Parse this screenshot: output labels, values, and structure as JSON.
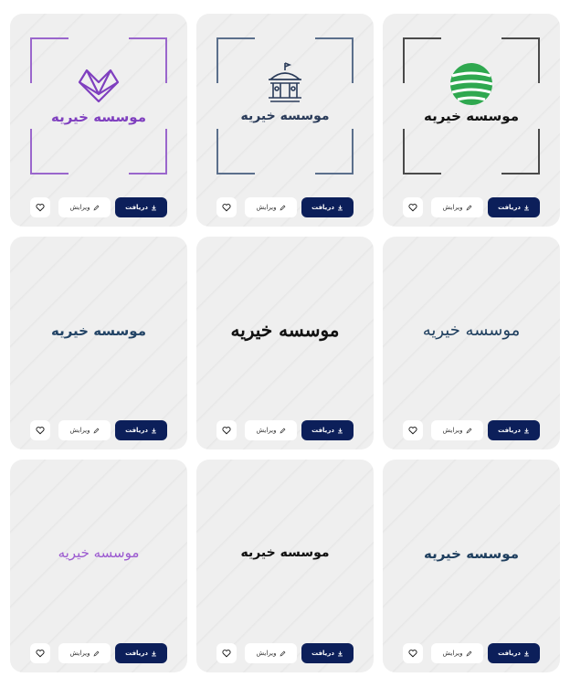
{
  "actions": {
    "download_label": "دریافت",
    "edit_label": "ویرایش",
    "like_icon": "heart-icon",
    "download_icon": "download-icon",
    "edit_icon": "pencil-icon"
  },
  "colors": {
    "download_button": "#0c1f5a",
    "card_background": "#efefef"
  },
  "cards": [
    {
      "logo_text": "موسسه خیریه",
      "icon": "globe-icon",
      "frame_color": "#4a4a4a",
      "text_color": "#111111"
    },
    {
      "logo_text": "موسسه خیریه",
      "icon": "carousel-icon",
      "frame_color": "#5b6f8c",
      "text_color": "#2b3c5a"
    },
    {
      "logo_text": "موسسه خیریه",
      "icon": "heart-box-icon",
      "frame_color": "#9a66cc",
      "text_color": "#7f3fbf"
    },
    {
      "logo_text": "موسسه خیریه",
      "text_color": "#234466"
    },
    {
      "logo_text": "موسسه خیریه",
      "text_color": "#111111"
    },
    {
      "logo_text": "موسسه خیریه",
      "text_color": "#1f3f5f"
    },
    {
      "logo_text": "موسسه خیریه",
      "text_color": "#1f3f5f"
    },
    {
      "logo_text": "موسسه خیریه",
      "text_color": "#111111"
    },
    {
      "logo_text": "موسسه خیریه",
      "text_color": "#9b59d0"
    }
  ]
}
